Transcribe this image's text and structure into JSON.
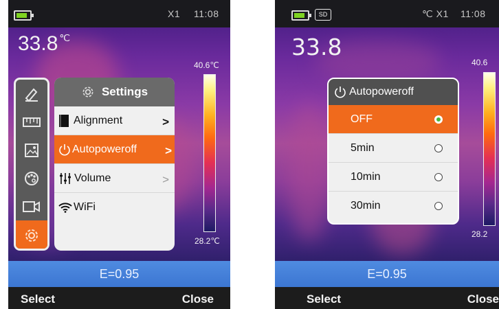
{
  "colors": {
    "accent": "#f06a1c",
    "status_bar": "#1a1a1e",
    "emissivity_bar": "#3c76d2",
    "footer": "#1c1c1c",
    "panel_header": "#6a6a6a",
    "popup_header": "#505050",
    "radio_selected": "#46b93e"
  },
  "left_screen": {
    "status": {
      "zoom": "X1",
      "time": "11:08"
    },
    "temperature": {
      "value": "33.8",
      "unit": "℃"
    },
    "scale": {
      "max": "40.6℃",
      "min": "28.2℃"
    },
    "side_menu": {
      "icons": [
        "pen-icon",
        "ruler-icon",
        "image-gallery-icon",
        "palette-icon",
        "video-camera-icon",
        "gear-icon"
      ],
      "selected_index": 5
    },
    "settings_panel": {
      "title": "Settings",
      "items": [
        {
          "label": "Alignment",
          "icon": "alignment-icon",
          "chevron": ">"
        },
        {
          "label": "Autopoweroff",
          "icon": "power-icon",
          "chevron": ">",
          "selected": true
        },
        {
          "label": "Volume",
          "icon": "volume-sliders-icon",
          "chevron": ">"
        },
        {
          "label": "WiFi",
          "icon": "wifi-icon"
        }
      ]
    },
    "emissivity": "E=0.95",
    "footer": {
      "select": "Select",
      "close": "Close"
    }
  },
  "right_screen": {
    "status": {
      "sd": "SD",
      "unit_zoom": "℃ X1",
      "time": "11:08"
    },
    "temperature": {
      "value": "33.8"
    },
    "scale": {
      "max": "40.6",
      "min": "28.2"
    },
    "popup": {
      "title": "Autopoweroff",
      "icon": "power-icon",
      "options": [
        {
          "label": "OFF",
          "selected": true
        },
        {
          "label": "5min"
        },
        {
          "label": "10min"
        },
        {
          "label": "30min"
        }
      ]
    },
    "emissivity": "E=0.95",
    "footer": {
      "select": "Select",
      "close": "Close"
    }
  }
}
